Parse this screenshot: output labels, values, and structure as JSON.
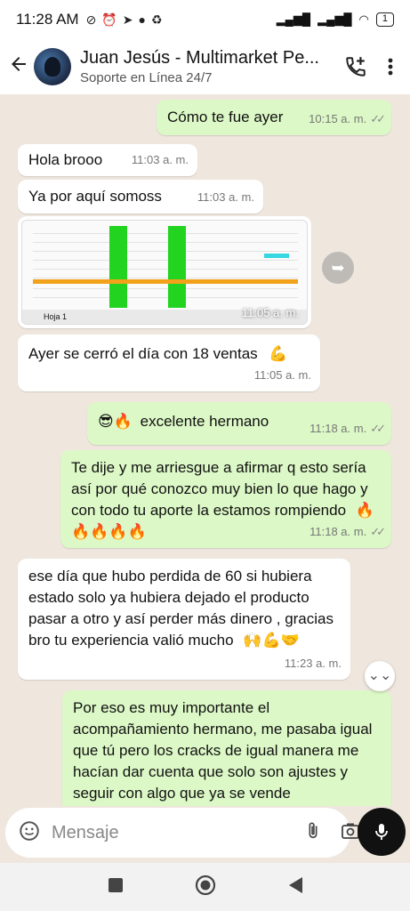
{
  "status": {
    "time": "11:28 AM",
    "battery": "1"
  },
  "header": {
    "title": "Juan Jesús - Multimarket Pe...",
    "subtitle": "Soporte en Línea 24/7"
  },
  "messages": [
    {
      "text": "Cómo te fue ayer",
      "time": "10:15 a. m."
    },
    {
      "text": "Hola brooo",
      "time": "11:03 a. m."
    },
    {
      "text": "Ya por aquí somoss",
      "time": "11:03 a. m."
    },
    {
      "image_time": "11:05 a. m.",
      "sheet_tab": "Hoja 1"
    },
    {
      "text": "Ayer se cerró el día con 18 ventas",
      "emoji": "💪",
      "time": "11:05 a. m."
    },
    {
      "emoji": "😎🔥",
      "text": "excelente hermano",
      "time": "11:18 a. m."
    },
    {
      "text": "Te dije y me arriesgue a afirmar q esto sería así por qué conozco muy bien lo que hago y con todo tu aporte la estamos rompiendo",
      "emoji": "🔥🔥🔥🔥🔥",
      "time": "11:18 a. m."
    },
    {
      "text": "ese día que hubo perdida de 60  si hubiera estado solo ya hubiera dejado el producto pasar a otro y así perder más dinero , gracias bro tu experiencia valió mucho",
      "emoji": "🙌💪🤝",
      "time": "11:23 a. m."
    },
    {
      "text": "Por eso es muy importante el acompañamiento hermano, me pasaba igual que tú pero los cracks de igual manera me hacían dar cuenta que solo son ajustes y seguir con algo que ya se vende"
    }
  ],
  "input": {
    "placeholder": "Mensaje"
  },
  "colors": {
    "outgoing": "#dcf8c6",
    "incoming": "#ffffff",
    "background": "#efe7de"
  }
}
